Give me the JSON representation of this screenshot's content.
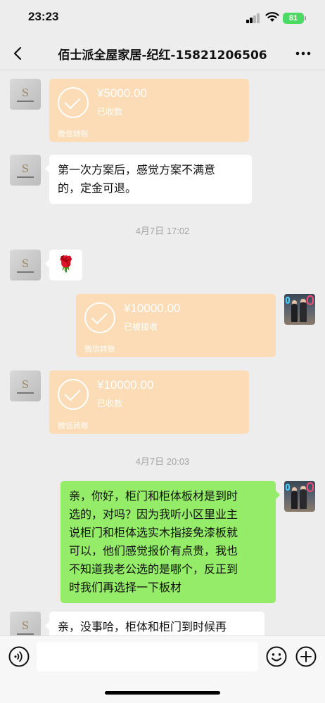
{
  "status_bar": {
    "time": "23:23",
    "battery": "81"
  },
  "header": {
    "title": "佰士派全屋家居-纪红-15821206506"
  },
  "messages": {
    "m1": {
      "amount": "¥5000.00",
      "status": "已收款",
      "source": "微信转账"
    },
    "m2": {
      "text_line1": "第一次方案后，感觉方案不满意",
      "text_line2": "的，定金可退。"
    },
    "ts1": "4月7日 17:02",
    "m3": {
      "emoji": "🌹"
    },
    "m4": {
      "amount": "¥10000.00",
      "status": "已被接收",
      "source": "微信转账"
    },
    "m5": {
      "amount": "¥10000.00",
      "status": "已收款",
      "source": "微信转账"
    },
    "ts2": "4月7日 20:03",
    "m6": {
      "line1": "亲，你好，柜门和柜体板材是到时",
      "line2": "选的，对吗？因为我听小区里业主",
      "line3": "说柜门和柜体选实木指接免漆板就",
      "line4": "可以，他们感觉报价有点贵，我也",
      "line5": "不知道我老公选的是哪个，反正到",
      "line6": "时我们再选择一下板材"
    },
    "m7": {
      "text": "亲，没事哈，柜体和柜门到时候再"
    }
  },
  "icons": {
    "back": "chevron-left-icon",
    "more": "more-dots-icon",
    "voice": "voice-icon",
    "emoji": "emoji-icon",
    "plus": "plus-icon"
  },
  "colors": {
    "background": "#ededed",
    "transfer_bubble": "#fcdcb6",
    "sent_bubble": "#95ec69",
    "received_bubble": "#ffffff",
    "battery": "#4cd964"
  }
}
